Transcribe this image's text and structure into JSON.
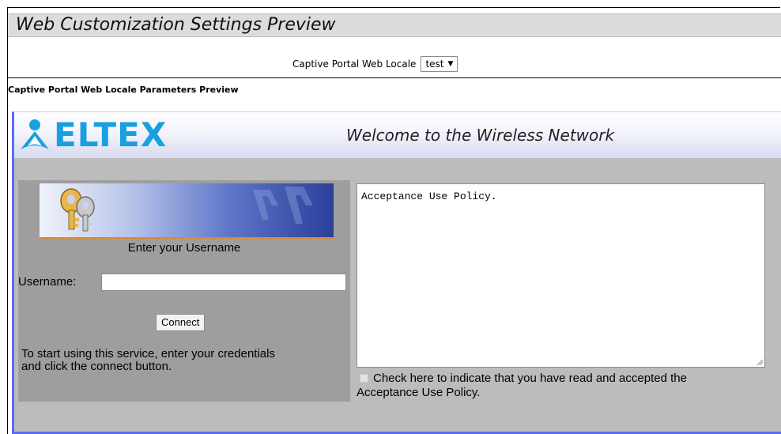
{
  "window": {
    "title": "Web Customization Settings Preview"
  },
  "locale": {
    "label": "Captive Portal Web Locale",
    "selected": "test"
  },
  "params_heading": "Captive Portal Web Locale Parameters Preview",
  "portal": {
    "logo_text": "ELTEX",
    "welcome": "Welcome to the Wireless Network",
    "enter_username": "Enter your Username",
    "username_label": "Username:",
    "username_value": "",
    "connect_label": "Connect",
    "instructions": "To start using this service, enter your credentials and click the connect button.",
    "aup_text": "Acceptance Use Policy.",
    "accept_label": "Check here to indicate that you have read and accepted the Acceptance Use Policy.",
    "accept_checked": false
  },
  "colors": {
    "accent": "#1aa0e0",
    "preview_border": "#5b6cf0",
    "panel_gray": "#9e9e9e"
  }
}
